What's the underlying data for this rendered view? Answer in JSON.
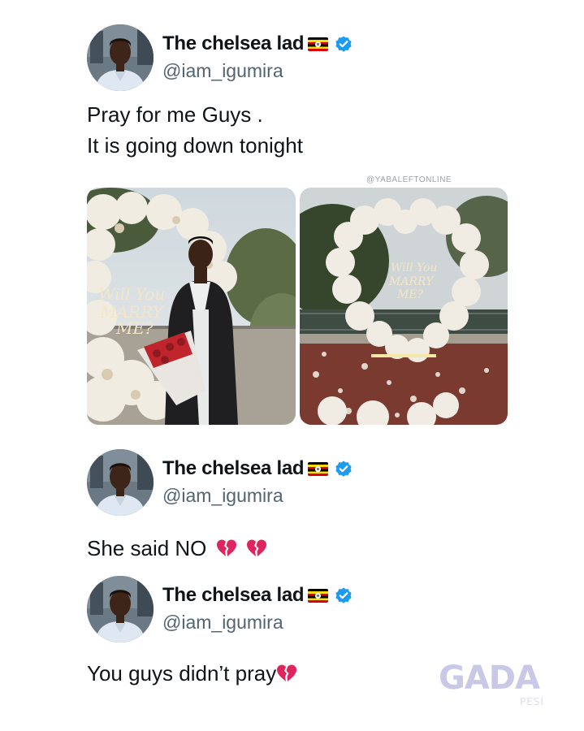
{
  "tweets": [
    {
      "display_name": "The chelsea lad",
      "handle": "@iam_igumira",
      "lines": [
        "Pray for me Guys .",
        "It is going down tonight"
      ]
    },
    {
      "display_name": "The chelsea lad",
      "handle": "@iam_igumira",
      "text": "She said NO"
    },
    {
      "display_name": "The chelsea lad",
      "handle": "@iam_igumira",
      "text": "You guys didn’t pray"
    }
  ],
  "media": {
    "credit": "@YABALEFTONLINE",
    "sign_text": [
      "Will You",
      "MARRY",
      "ME?"
    ]
  },
  "brand": {
    "logo_text": "GADA",
    "logo_subtext": "PESI"
  },
  "colors": {
    "verified": "#1d9bf0",
    "text": "#0f1419",
    "handle": "#536471",
    "broken_heart": "#e0245e"
  },
  "icons": [
    "avatar",
    "uganda-flag-icon",
    "verified-badge-icon",
    "broken-heart-icon"
  ]
}
